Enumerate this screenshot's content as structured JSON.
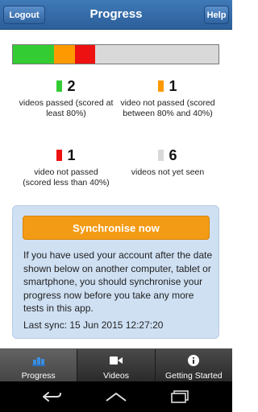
{
  "header": {
    "title": "Progress",
    "logout_label": "Logout",
    "help_label": "Help"
  },
  "progress_bar": {
    "segments": [
      {
        "status": "passed",
        "count": 2,
        "color": "#33cc33"
      },
      {
        "status": "not_passed_between",
        "count": 1,
        "color": "#ff9900"
      },
      {
        "status": "not_passed_less",
        "count": 1,
        "color": "#ee1111"
      },
      {
        "status": "not_yet_seen",
        "count": 6,
        "color": "#d9d9d9"
      }
    ]
  },
  "stats": {
    "passed": {
      "count": "2",
      "text": "videos passed (scored at least 80%)",
      "color": "#33cc33"
    },
    "not_passed_between": {
      "count": "1",
      "text": "video not passed (scored between 80% and 40%)",
      "color": "#ff9900"
    },
    "not_passed_less": {
      "count": "1",
      "text": "video not passed (scored less than 40%)",
      "color": "#ee1111"
    },
    "not_yet_seen": {
      "count": "6",
      "text": "videos not yet seen",
      "color": "#d9d9d9"
    }
  },
  "sync": {
    "button_label": "Synchronise now",
    "info": "If you have used your account after the date shown below on another computer, tablet or smartphone, you should synchronise your progress now before you take any more tests in this app.",
    "last_sync": "Last sync: 15 Jun 2015 12:27:20"
  },
  "tabs": [
    {
      "label": "Progress",
      "icon": "progress-icon",
      "active": true
    },
    {
      "label": "Videos",
      "icon": "video-camera-icon",
      "active": false
    },
    {
      "label": "Getting Started",
      "icon": "info-icon",
      "active": false
    }
  ],
  "navbar": {
    "icons": [
      "back-icon",
      "home-icon",
      "recent-apps-icon"
    ]
  }
}
